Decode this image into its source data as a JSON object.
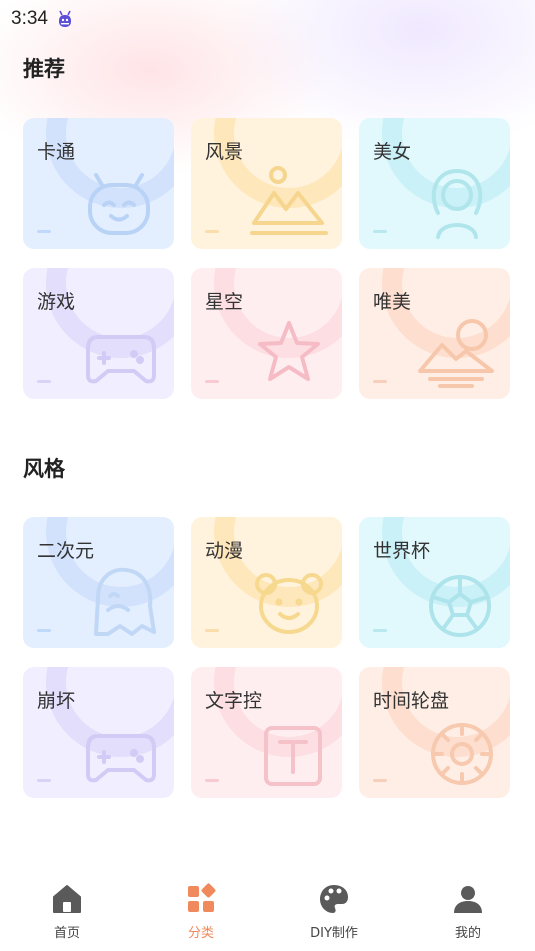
{
  "status_bar": {
    "time": "3:34"
  },
  "sections": [
    {
      "title": "推荐",
      "cards": [
        {
          "label": "卡通",
          "icon": "robot-face-icon",
          "theme": "blue"
        },
        {
          "label": "风景",
          "icon": "mountain-landscape-icon",
          "theme": "yellow"
        },
        {
          "label": "美女",
          "icon": "woman-portrait-icon",
          "theme": "cyan"
        },
        {
          "label": "游戏",
          "icon": "gamepad-icon",
          "theme": "purple"
        },
        {
          "label": "星空",
          "icon": "star-icon",
          "theme": "pink"
        },
        {
          "label": "唯美",
          "icon": "sunset-mountain-icon",
          "theme": "peach"
        }
      ]
    },
    {
      "title": "风格",
      "cards": [
        {
          "label": "二次元",
          "icon": "ghost-character-icon",
          "theme": "blue"
        },
        {
          "label": "动漫",
          "icon": "bear-face-icon",
          "theme": "yellow"
        },
        {
          "label": "世界杯",
          "icon": "soccer-ball-icon",
          "theme": "cyan"
        },
        {
          "label": "崩坏",
          "icon": "gamepad-icon",
          "theme": "purple"
        },
        {
          "label": "文字控",
          "icon": "text-box-icon",
          "theme": "pink"
        },
        {
          "label": "时间轮盘",
          "icon": "time-wheel-icon",
          "theme": "peach"
        }
      ]
    }
  ],
  "tab_bar": {
    "items": [
      {
        "label": "首页",
        "icon": "home-icon",
        "active": false
      },
      {
        "label": "分类",
        "icon": "category-grid-icon",
        "active": true
      },
      {
        "label": "DIY制作",
        "icon": "palette-icon",
        "active": false
      },
      {
        "label": "我的",
        "icon": "user-icon",
        "active": false
      }
    ],
    "active_color": "#f08a5d",
    "inactive_color": "#555555"
  }
}
